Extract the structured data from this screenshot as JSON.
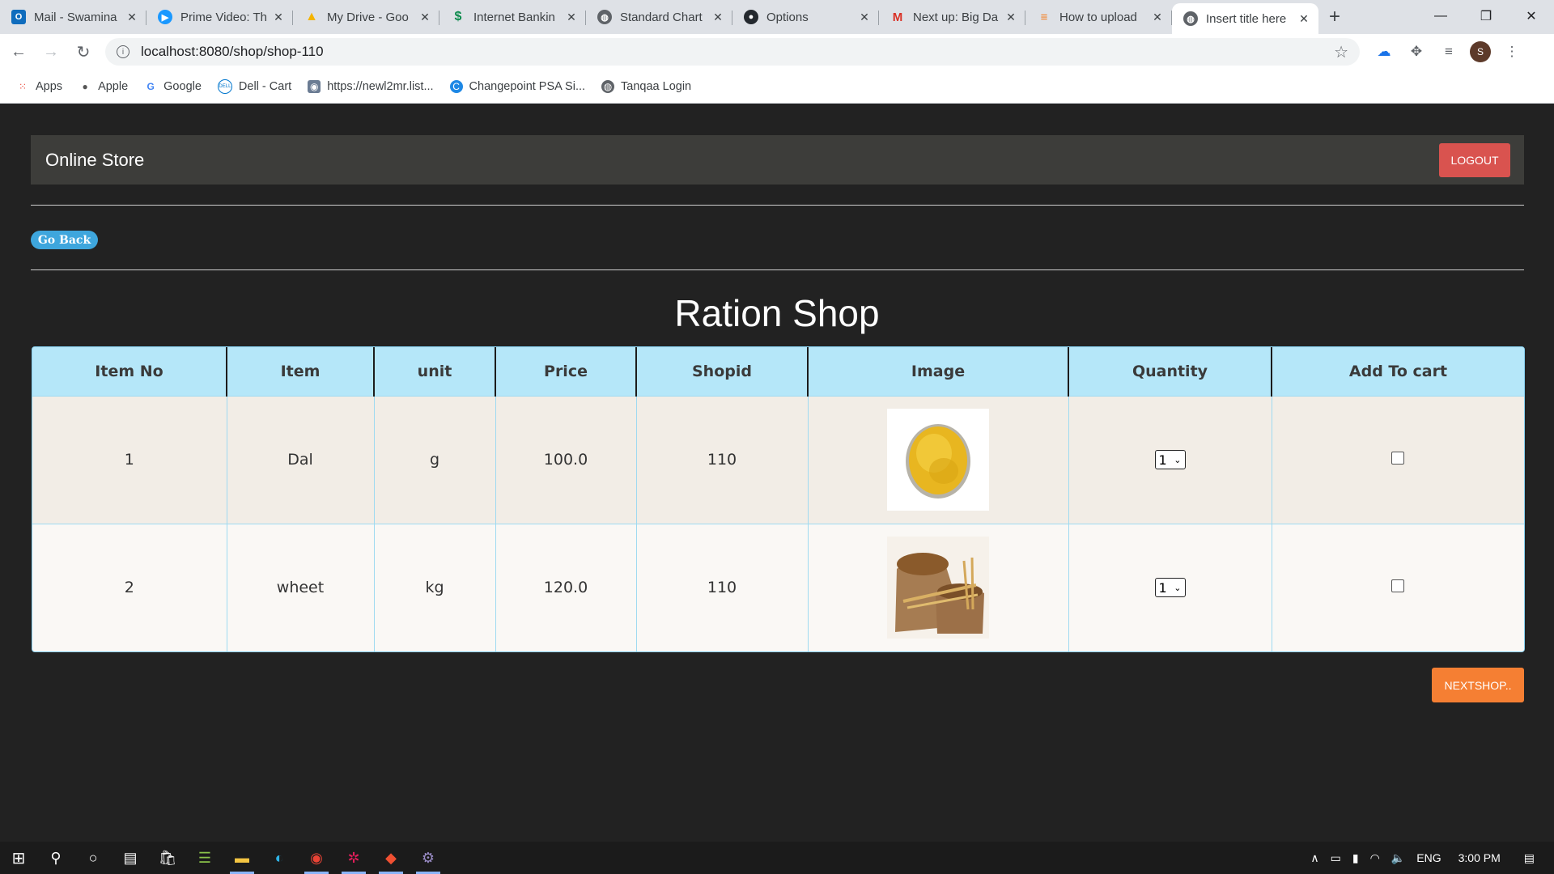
{
  "browser": {
    "tabs": [
      {
        "title": "Mail - Swamina",
        "icon": "outlook-icon",
        "color": "#0f6cbd"
      },
      {
        "title": "Prime Video: Th",
        "icon": "prime-video-icon",
        "color": "#1a98ff"
      },
      {
        "title": "My Drive - Goo",
        "icon": "google-drive-icon",
        "color": "#f4b400"
      },
      {
        "title": "Internet Bankin",
        "icon": "bank-icon",
        "color": "#0a8a4b"
      },
      {
        "title": "Standard Chart",
        "icon": "globe-icon",
        "color": "#5f6368"
      },
      {
        "title": "Options",
        "icon": "github-icon",
        "color": "#24292e"
      },
      {
        "title": "Next up: Big Da",
        "icon": "gmail-icon",
        "color": "#d93025"
      },
      {
        "title": "How to upload",
        "icon": "stack-overflow-icon",
        "color": "#f48024"
      },
      {
        "title": "Insert title here",
        "icon": "globe-icon",
        "color": "#5f6368"
      }
    ],
    "url": "localhost:8080/shop/shop-110",
    "profile_initial": "S",
    "bookmarks": [
      {
        "label": "Apps",
        "icon": "apps-grid-icon"
      },
      {
        "label": "Apple",
        "icon": "apple-icon"
      },
      {
        "label": "Google",
        "icon": "google-icon"
      },
      {
        "label": "Dell - Cart",
        "icon": "dell-icon"
      },
      {
        "label": "https://newl2mr.list...",
        "icon": "site-icon"
      },
      {
        "label": "Changepoint PSA Si...",
        "icon": "changepoint-icon"
      },
      {
        "label": "Tanqaa Login",
        "icon": "globe-icon"
      }
    ]
  },
  "app": {
    "brand": "Online Store",
    "logout_label": "LOGOUT",
    "go_back_label": "Go Back",
    "page_title": "Ration Shop",
    "next_shop_label": "NEXTSHOP..",
    "colors": {
      "logout": "#d9534f",
      "go_back": "#3ea6dd",
      "next_shop": "#f57f33",
      "table_header": "#b5e7f9"
    }
  },
  "table": {
    "headers": [
      "Item No",
      "Item",
      "unit",
      "Price",
      "Shopid",
      "Image",
      "Quantity",
      "Add To cart"
    ],
    "rows": [
      {
        "item_no": "1",
        "item": "Dal",
        "unit": "g",
        "price": "100.0",
        "shopid": "110",
        "image": "dal-bowl-image",
        "quantity": "1"
      },
      {
        "item_no": "2",
        "item": "wheet",
        "unit": "kg",
        "price": "120.0",
        "shopid": "110",
        "image": "wheat-sack-image",
        "quantity": "1"
      }
    ]
  },
  "taskbar": {
    "language": "ENG",
    "time": "3:00 PM"
  }
}
